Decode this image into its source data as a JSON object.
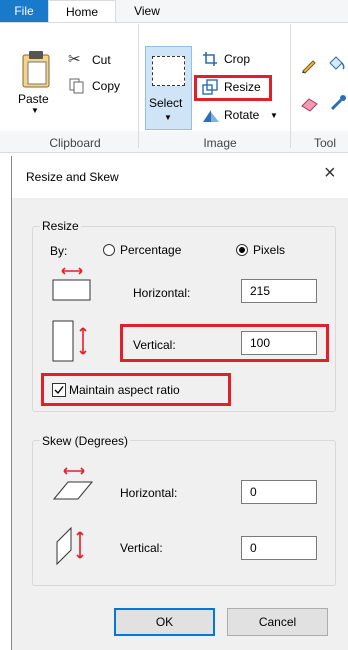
{
  "ribbon": {
    "tabs": {
      "file": "File",
      "home": "Home",
      "view": "View"
    },
    "clipboard": {
      "paste": "Paste",
      "cut": "Cut",
      "copy": "Copy",
      "label": "Clipboard"
    },
    "image": {
      "select": "Select",
      "crop": "Crop",
      "resize": "Resize",
      "rotate": "Rotate",
      "label": "Image"
    },
    "tools": {
      "label": "Tool"
    }
  },
  "dialog": {
    "title": "Resize and Skew",
    "close_glyph": "×",
    "resize": {
      "legend": "Resize",
      "by_label": "By:",
      "option_percentage": "Percentage",
      "option_pixels": "Pixels",
      "selected_option": "Pixels",
      "horizontal_label": "Horizontal:",
      "horizontal_value": "215",
      "vertical_label": "Vertical:",
      "vertical_value": "100",
      "maintain_aspect_label": "Maintain aspect ratio",
      "maintain_aspect_checked": true
    },
    "skew": {
      "legend": "Skew (Degrees)",
      "horizontal_label": "Horizontal:",
      "horizontal_value": "0",
      "vertical_label": "Vertical:",
      "vertical_value": "0"
    },
    "ok_label": "OK",
    "cancel_label": "Cancel"
  },
  "colors": {
    "file_tab": "#1979ca",
    "highlight": "#e0202a",
    "arrow": "#e0202a"
  }
}
